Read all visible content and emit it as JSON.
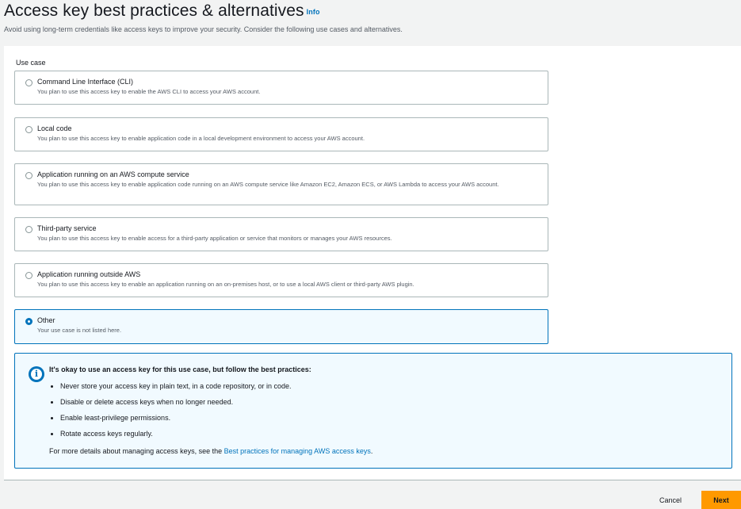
{
  "header": {
    "title": "Access key best practices & alternatives",
    "info_label": "Info",
    "subtitle": "Avoid using long-term credentials like access keys to improve your security. Consider the following use cases and alternatives."
  },
  "use_case": {
    "label": "Use case",
    "selected": "other",
    "options": [
      {
        "id": "cli",
        "title": "Command Line Interface (CLI)",
        "description": "You plan to use this access key to enable the AWS CLI to access your AWS account."
      },
      {
        "id": "local-code",
        "title": "Local code",
        "description": "You plan to use this access key to enable application code in a local development environment to access your AWS account."
      },
      {
        "id": "aws-compute",
        "title": "Application running on an AWS compute service",
        "description": "You plan to use this access key to enable application code running on an AWS compute service like Amazon EC2, Amazon ECS, or AWS Lambda to access your AWS account."
      },
      {
        "id": "third-party",
        "title": "Third-party service",
        "description": "You plan to use this access key to enable access for a third-party application or service that monitors or manages your AWS resources."
      },
      {
        "id": "outside-aws",
        "title": "Application running outside AWS",
        "description": "You plan to use this access key to enable an application running on an on-premises host, or to use a local AWS client or third-party AWS plugin."
      },
      {
        "id": "other",
        "title": "Other",
        "description": "Your use case is not listed here."
      }
    ]
  },
  "alert": {
    "title": "It's okay to use an access key for this use case, but follow the best practices:",
    "items": [
      "Never store your access key in plain text, in a code repository, or in code.",
      "Disable or delete access keys when no longer needed.",
      "Enable least-privilege permissions.",
      "Rotate access keys regularly."
    ],
    "footer_prefix": "For more details about managing access keys, see the ",
    "footer_link": "Best practices for managing AWS access keys",
    "footer_suffix": ".",
    "icon": "info-icon"
  },
  "actions": {
    "cancel_label": "Cancel",
    "next_label": "Next"
  },
  "colors": {
    "accent": "#0073bb",
    "primary_button": "#ff9900",
    "background": "#f2f3f3"
  }
}
